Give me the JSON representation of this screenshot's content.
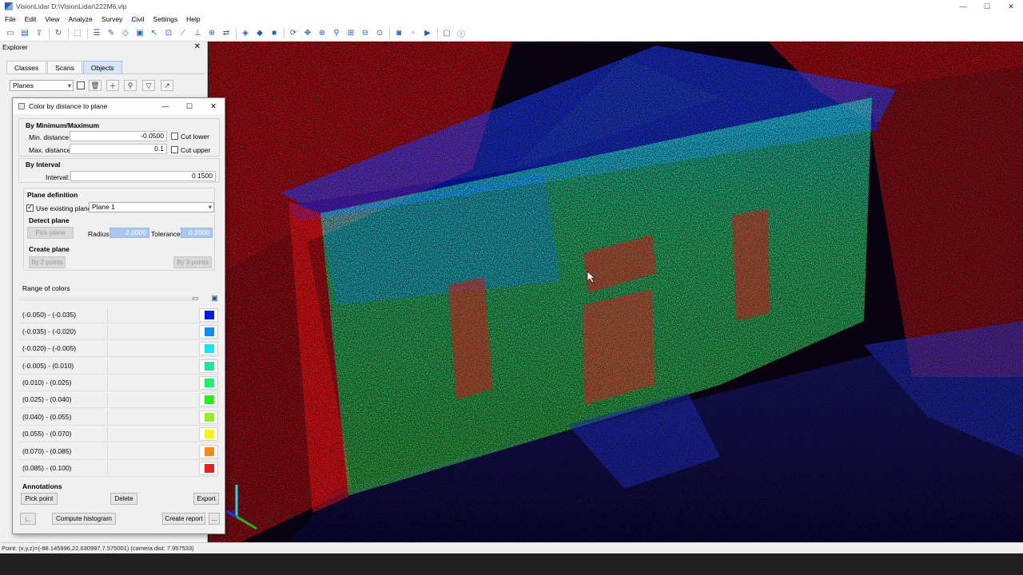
{
  "window": {
    "title": "VisionLidar  D:\\VisionLidar\\222M6.vlp",
    "controls": {
      "minimize": "—",
      "maximize": "☐",
      "close": "✕"
    }
  },
  "menu": [
    "File",
    "Edit",
    "View",
    "Analyze",
    "Survey",
    "Civil",
    "Settings",
    "Help"
  ],
  "toolbar_icons": [
    "new-file-icon",
    "open-folder-icon",
    "upload-icon",
    "refresh-icon",
    "select-icon",
    "layers-icon",
    "lasso-icon",
    "polygon-icon",
    "box-select-icon",
    "pointer-icon",
    "measure-icon",
    "height-icon",
    "fit-icon",
    "pan-icon",
    "cube-icon",
    "cube-alt-icon",
    "cube-side-icon",
    "rotate-icon",
    "move-icon",
    "zoom-in-icon",
    "zoom-icon",
    "zoom-window-icon",
    "zoom-out-icon",
    "orbit-icon",
    "camera-icon",
    "play-icon",
    "screenshot-icon",
    "info-icon"
  ],
  "explorer": {
    "title": "Explorer",
    "tabs": [
      "Classes",
      "Scans",
      "Objects"
    ],
    "active_tab": "Objects",
    "dropdown_value": "Planes"
  },
  "dialog": {
    "title": "Color by distance to plane",
    "minmax": {
      "title": "By Minimum/Maximum",
      "min_label": "Min. distance",
      "min_value": "-0.0500",
      "max_label": "Max. distance",
      "max_value": "0.1",
      "cut_lower": "Cut lower",
      "cut_upper": "Cut upper"
    },
    "interval": {
      "title": "By Interval",
      "label": "Interval:",
      "value": "0.1500"
    },
    "plane": {
      "title": "Plane definition",
      "use_existing": "Use existing plane",
      "plane_value": "Plane 1",
      "detect_title": "Detect plane",
      "pick_plane": "Pick plane",
      "radius_label": "Radius:",
      "radius_value": "2.0000",
      "tolerance_label": "Tolerance:",
      "tolerance_value": "0.2000",
      "create_title": "Create plane",
      "by2": "By 2 points",
      "by3": "By 3 points"
    },
    "range_title": "Range of colors",
    "ranges": [
      {
        "label": "(-0.050) - (-0.035)",
        "color": "#0018ff"
      },
      {
        "label": "(-0.035) - (-0.020)",
        "color": "#0a8cff"
      },
      {
        "label": "(-0.020) - (-0.005)",
        "color": "#13e6f5"
      },
      {
        "label": "(-0.005) - (0.010)",
        "color": "#1de6a0"
      },
      {
        "label": "(0.010) - (0.025)",
        "color": "#1cf073"
      },
      {
        "label": "(0.025) - (0.040)",
        "color": "#22f01b"
      },
      {
        "label": "(0.040) - (0.055)",
        "color": "#8ef01e"
      },
      {
        "label": "(0.055) - (0.070)",
        "color": "#f7f21a"
      },
      {
        "label": "(0.070) - (0.085)",
        "color": "#f78a16"
      },
      {
        "label": "(0.085) - (0.100)",
        "color": "#f51a1a"
      }
    ],
    "annotations": {
      "title": "Annotations",
      "pick_point": "Pick point",
      "delete": "Delete",
      "export": "Export"
    },
    "footer": {
      "compute_histogram": "Compute histogram",
      "create_report": "Create report",
      "more": "..."
    }
  },
  "status": "Point: (x,y,z)=(-88.145996,22.630997,7.575001) (camera dist: 7.957533)"
}
